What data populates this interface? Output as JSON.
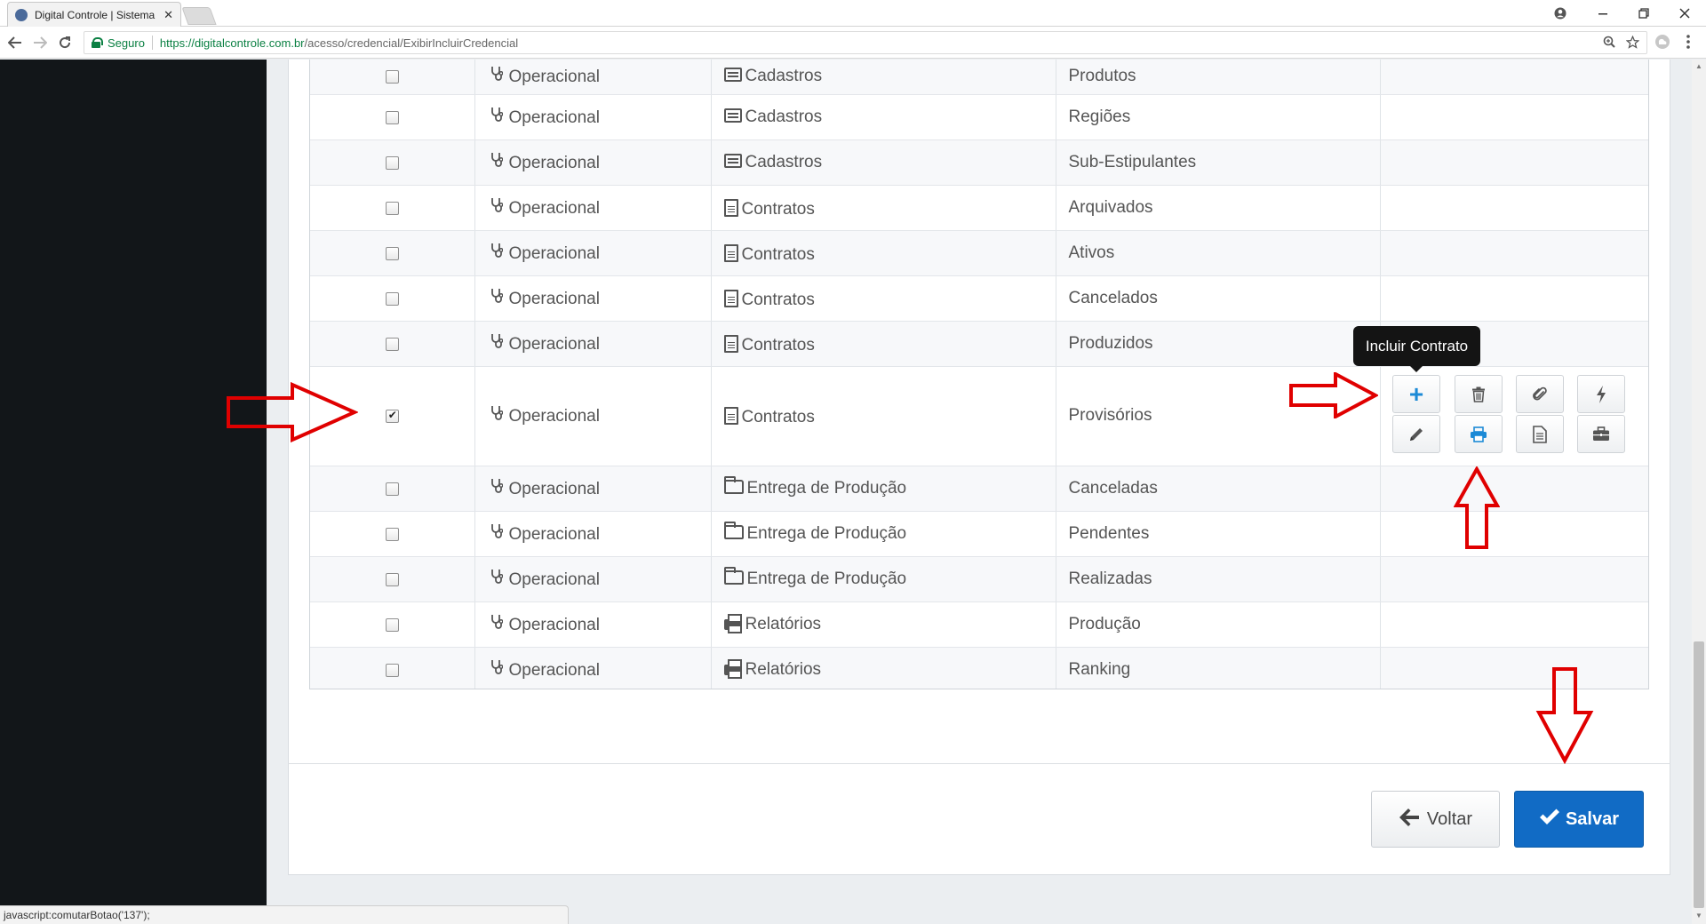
{
  "browser": {
    "tab_title": "Digital Controle | Sistema",
    "tab_close": "✕",
    "secure_label": "Seguro",
    "url_host": "https://digitalcontrole.com.br",
    "url_path": "/acesso/credencial/ExibirIncluirCredencial",
    "status_text": "javascript:comutarBotao('137');"
  },
  "rows": [
    {
      "module": "Operacional",
      "menu": "Cadastros",
      "menu_icon": "list-icon",
      "item": "Produtos",
      "checked": false
    },
    {
      "module": "Operacional",
      "menu": "Cadastros",
      "menu_icon": "list-icon",
      "item": "Regiões",
      "checked": false
    },
    {
      "module": "Operacional",
      "menu": "Cadastros",
      "menu_icon": "list-icon",
      "item": "Sub-Estipulantes",
      "checked": false
    },
    {
      "module": "Operacional",
      "menu": "Contratos",
      "menu_icon": "file-icon",
      "item": "Arquivados",
      "checked": false
    },
    {
      "module": "Operacional",
      "menu": "Contratos",
      "menu_icon": "file-icon",
      "item": "Ativos",
      "checked": false
    },
    {
      "module": "Operacional",
      "menu": "Contratos",
      "menu_icon": "file-icon",
      "item": "Cancelados",
      "checked": false
    },
    {
      "module": "Operacional",
      "menu": "Contratos",
      "menu_icon": "file-icon",
      "item": "Produzidos",
      "checked": false
    },
    {
      "module": "Operacional",
      "menu": "Contratos",
      "menu_icon": "file-icon",
      "item": "Provisórios",
      "checked": true
    },
    {
      "module": "Operacional",
      "menu": "Entrega de Produção",
      "menu_icon": "folder-icon",
      "item": "Canceladas",
      "checked": false
    },
    {
      "module": "Operacional",
      "menu": "Entrega de Produção",
      "menu_icon": "folder-icon",
      "item": "Pendentes",
      "checked": false
    },
    {
      "module": "Operacional",
      "menu": "Entrega de Produção",
      "menu_icon": "folder-icon",
      "item": "Realizadas",
      "checked": false
    },
    {
      "module": "Operacional",
      "menu": "Relatórios",
      "menu_icon": "print-icon",
      "item": "Produção",
      "checked": false
    },
    {
      "module": "Operacional",
      "menu": "Relatórios",
      "menu_icon": "print-icon",
      "item": "Ranking",
      "checked": false
    }
  ],
  "tooltip": "Incluir Contrato",
  "actions": [
    {
      "icon": "plus-icon",
      "active": true
    },
    {
      "icon": "trash-icon",
      "active": false
    },
    {
      "icon": "paperclip-icon",
      "active": false
    },
    {
      "icon": "bolt-icon",
      "active": false
    },
    {
      "icon": "pencil-icon",
      "active": false
    },
    {
      "icon": "print-icon",
      "active": true
    },
    {
      "icon": "file-icon",
      "active": false
    },
    {
      "icon": "briefcase-icon",
      "active": false
    }
  ],
  "buttons": {
    "back_label": "Voltar",
    "save_label": "Salvar"
  },
  "colors": {
    "primary": "#116bc5",
    "active_icon": "#1c8ad6",
    "annotation": "#e00000",
    "sidebar": "#121619"
  }
}
